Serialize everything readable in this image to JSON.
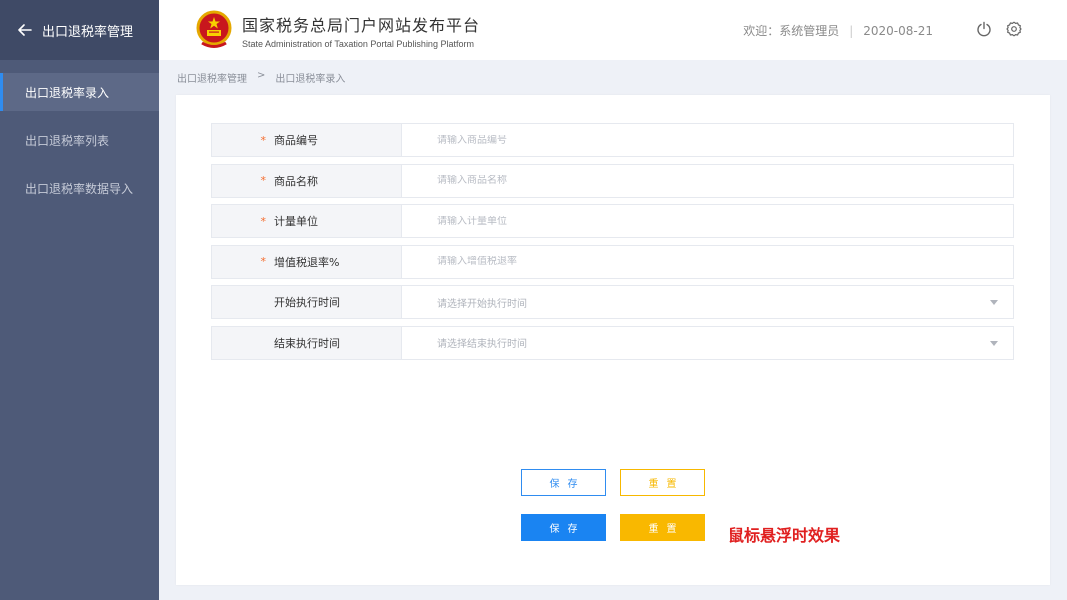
{
  "sidebar": {
    "title": "出口退税率管理",
    "items": [
      {
        "label": "出口退税率录入",
        "active": true
      },
      {
        "label": "出口退税率列表",
        "active": false
      },
      {
        "label": "出口退税率数据导入",
        "active": false
      }
    ]
  },
  "header": {
    "brand_cn": "国家税务总局门户网站发布平台",
    "brand_en": "State Administration of Taxation Portal Publishing Platform",
    "welcome": "欢迎：系统管理员",
    "separator": "|",
    "date": "2020-08-21"
  },
  "breadcrumb": {
    "parent": "出口退税率管理",
    "separator": ">",
    "current": "出口退税率录入"
  },
  "form": {
    "fields": [
      {
        "required": true,
        "label": "商品编号",
        "placeholder": "请输入商品编号",
        "type": "input"
      },
      {
        "required": true,
        "label": "商品名称",
        "placeholder": "请输入商品名称",
        "type": "input"
      },
      {
        "required": true,
        "label": "计量单位",
        "placeholder": "请输入计量单位",
        "type": "input"
      },
      {
        "required": true,
        "label": "增值税退率%",
        "placeholder": "请输入增值税退率",
        "type": "input"
      },
      {
        "required": false,
        "label": "开始执行时间",
        "placeholder": "请选择开始执行时间",
        "type": "select"
      },
      {
        "required": false,
        "label": "结束执行时间",
        "placeholder": "请选择结束执行时间",
        "type": "select"
      }
    ],
    "required_mark": "*"
  },
  "buttons": {
    "save_label": "保存",
    "reset_label": "重置",
    "hover_note": "鼠标悬浮时效果"
  },
  "colors": {
    "primary": "#2f8cf0",
    "warning": "#f7b800",
    "sidebar_bg": "#4e5a78",
    "note": "#e02020"
  },
  "icons": [
    "back-arrow-icon",
    "national-emblem-icon",
    "power-icon",
    "settings-gear-icon",
    "dropdown-caret-icon"
  ]
}
